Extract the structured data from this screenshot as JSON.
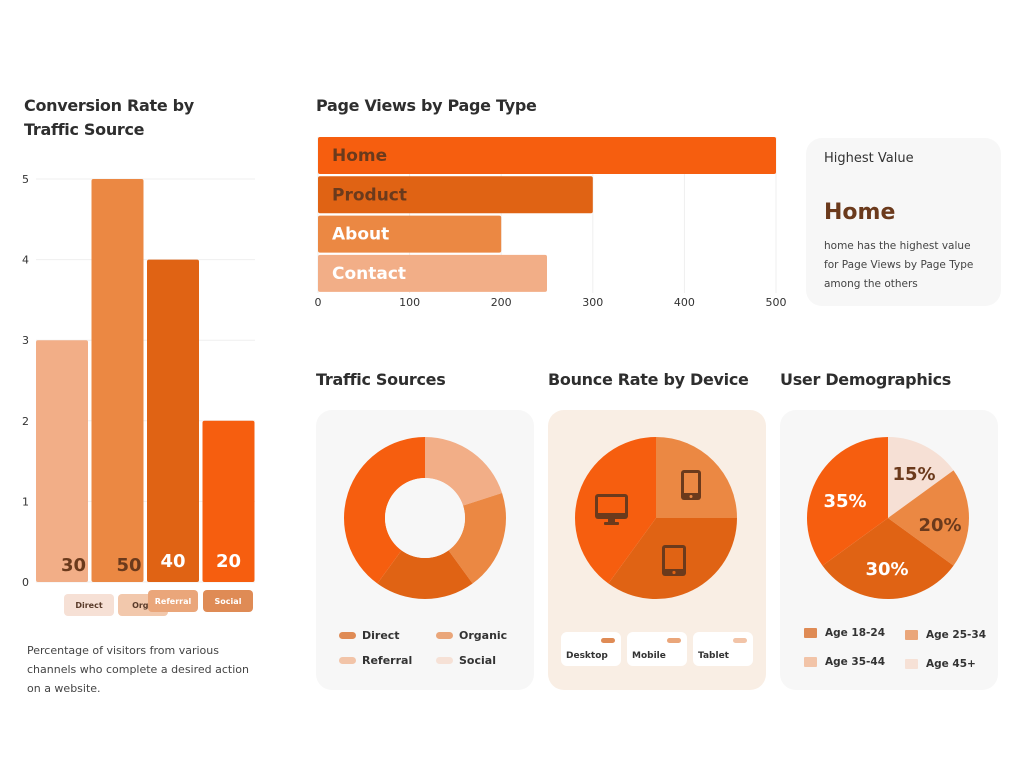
{
  "colors": {
    "bright": "#f65e0f",
    "dark": "#e06314",
    "medium": "#eb8843",
    "light": "#f2ae87",
    "pale": "#f6e0d5",
    "brown": "#6b3a1c",
    "legend_direct": "#df8b55",
    "legend_organic": "#eaa67a",
    "legend_referral": "#f2c4a8",
    "legend_social": "#f6e1d6"
  },
  "chart_data": [
    {
      "type": "bar",
      "title": "Conversion Rate by Traffic Source",
      "categories": [
        "Direct",
        "Organic",
        "Referral",
        "Social"
      ],
      "values": [
        3,
        5,
        4,
        2
      ],
      "data_labels": [
        "30",
        "50",
        "40",
        "20"
      ],
      "yticks": [
        "0",
        "1",
        "2",
        "3",
        "4",
        "5"
      ],
      "ylim": [
        0,
        5
      ],
      "xlabel": "",
      "ylabel": "",
      "grid": true,
      "description": "Percentage of visitors from various channels who complete a desired action on a website."
    },
    {
      "type": "bar",
      "orientation": "horizontal",
      "title": "Page Views by Page Type",
      "categories": [
        "Home",
        "Product",
        "About",
        "Contact"
      ],
      "values": [
        500,
        300,
        200,
        250
      ],
      "xticks": [
        "0",
        "100",
        "200",
        "300",
        "400",
        "500"
      ],
      "xlim": [
        0,
        500
      ],
      "grid": true
    },
    {
      "type": "pie",
      "variant": "donut",
      "title": "Traffic Sources",
      "categories": [
        "Referral",
        "Organic",
        "Direct",
        "Social"
      ],
      "values": [
        20,
        20,
        20,
        40
      ],
      "legend": [
        "Direct",
        "Organic",
        "Referral",
        "Social"
      ],
      "legend_placement": "bottom"
    },
    {
      "type": "pie",
      "title": "Bounce Rate by Device",
      "categories": [
        "Mobile",
        "Tablet",
        "Desktop"
      ],
      "values": [
        25,
        35,
        40
      ],
      "icons": [
        "mobile-phone-icon",
        "tablet-icon",
        "desktop-monitor-icon"
      ],
      "legend": [
        "Desktop",
        "Mobile",
        "Tablet"
      ],
      "legend_placement": "bottom"
    },
    {
      "type": "pie",
      "title": "User Demographics",
      "categories": [
        "Age 45+",
        "Age 25-34",
        "Age 35-44",
        "Age 18-24"
      ],
      "values": [
        15,
        20,
        30,
        35
      ],
      "data_labels": [
        "15%",
        "20%",
        "30%",
        "35%"
      ],
      "legend": [
        "Age 18-24",
        "Age 25-34",
        "Age 35-44",
        "Age 45+"
      ],
      "legend_placement": "bottom"
    }
  ],
  "highlight": {
    "heading": "Highest Value",
    "value": "Home",
    "text": "home has the highest value for Page Views by Page Type among the others"
  }
}
